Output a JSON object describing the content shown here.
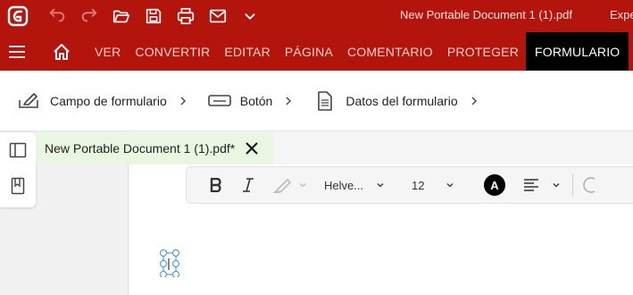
{
  "titlebar": {
    "document_title": "New Portable Document 1 (1).pdf",
    "app_name_partial": "Expe"
  },
  "menu": {
    "items": [
      {
        "label": "VER"
      },
      {
        "label": "CONVERTIR"
      },
      {
        "label": "EDITAR"
      },
      {
        "label": "PÁGINA"
      },
      {
        "label": "COMENTARIO"
      },
      {
        "label": "PROTEGER"
      },
      {
        "label": "FORMULARIO",
        "active": true
      }
    ]
  },
  "ribbon": {
    "groups": [
      {
        "label": "Campo de formulario",
        "icon": "form-field-icon"
      },
      {
        "label": "Botón",
        "icon": "button-icon"
      },
      {
        "label": "Datos del formulario",
        "icon": "document-icon"
      }
    ]
  },
  "tab": {
    "label": "New Portable Document 1 (1).pdf*"
  },
  "format_toolbar": {
    "font_family": "Helve...",
    "font_size": "12",
    "text_color_letter": "A"
  },
  "colors": {
    "brand": "#b3150d",
    "active_menu": "#000000",
    "tab_bg": "#e9f6e2",
    "selection": "#3a8fd6"
  }
}
